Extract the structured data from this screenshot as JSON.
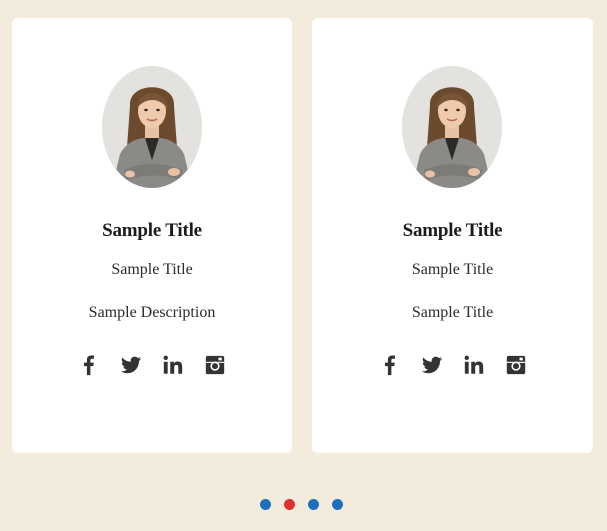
{
  "colors": {
    "background": "#f3ecdd",
    "card": "#ffffff",
    "icon": "#333333",
    "dot_inactive": "#1f6fbf",
    "dot_active": "#e03131"
  },
  "cards": [
    {
      "title": "Sample Title",
      "subtitle": "Sample Title",
      "description": "Sample Description",
      "avatar_icon": "profile-photo",
      "socials": [
        "facebook-icon",
        "twitter-icon",
        "linkedin-icon",
        "instagram-icon"
      ]
    },
    {
      "title": "Sample Title",
      "subtitle": "Sample Title",
      "description": "Sample Title",
      "avatar_icon": "profile-photo",
      "socials": [
        "facebook-icon",
        "twitter-icon",
        "linkedin-icon",
        "instagram-icon"
      ]
    }
  ],
  "pagination": {
    "count": 4,
    "active_index": 1
  }
}
